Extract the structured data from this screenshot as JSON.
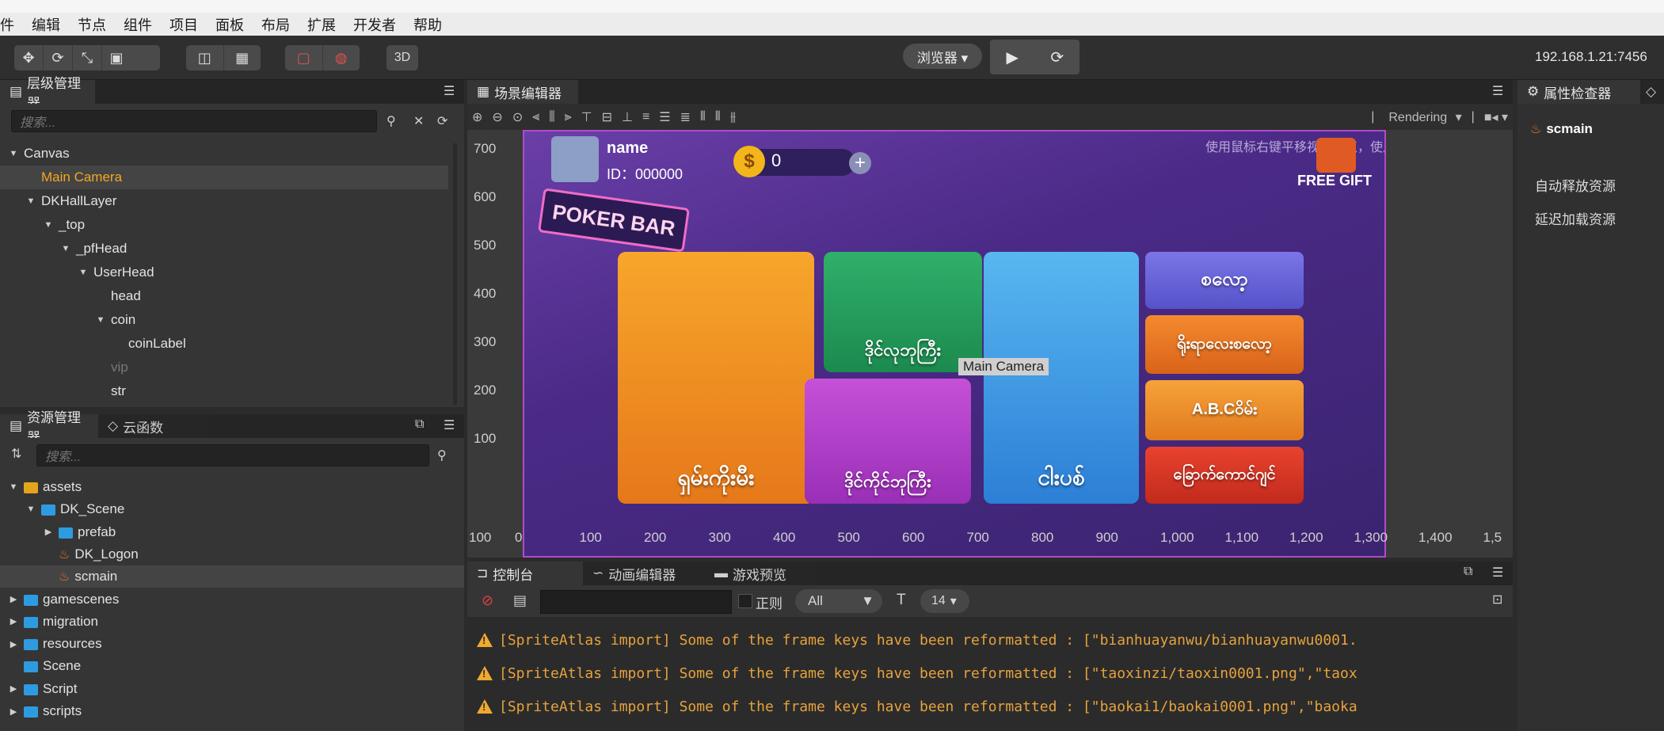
{
  "menubar": [
    "件",
    "编辑",
    "节点",
    "组件",
    "项目",
    "面板",
    "布局",
    "扩展",
    "开发者",
    "帮助"
  ],
  "toolbar": {
    "btn_3d": "3D",
    "browser_label": "浏览器 ▾",
    "ip": "192.168.1.21:7456"
  },
  "hierarchy": {
    "tab": "层级管理器",
    "search_placeholder": "搜索...",
    "nodes": [
      {
        "label": "Canvas",
        "depth": 0,
        "arrow": "▼"
      },
      {
        "label": "Main Camera",
        "depth": 1,
        "arrow": "",
        "selected": true
      },
      {
        "label": "DKHallLayer",
        "depth": 1,
        "arrow": "▼"
      },
      {
        "label": "_top",
        "depth": 2,
        "arrow": "▼"
      },
      {
        "label": "_pfHead",
        "depth": 3,
        "arrow": "▼"
      },
      {
        "label": "UserHead",
        "depth": 4,
        "arrow": "▼"
      },
      {
        "label": "head",
        "depth": 5,
        "arrow": ""
      },
      {
        "label": "coin",
        "depth": 5,
        "arrow": "▼"
      },
      {
        "label": "coinLabel",
        "depth": 6,
        "arrow": ""
      },
      {
        "label": "vip",
        "depth": 5,
        "arrow": "",
        "dim": true
      },
      {
        "label": "str",
        "depth": 5,
        "arrow": ""
      }
    ]
  },
  "assets": {
    "tab": "资源管理器",
    "tab2": "云函数",
    "search_placeholder": "搜索...",
    "items": [
      {
        "label": "assets",
        "depth": 0,
        "arrow": "▼",
        "kind": "db"
      },
      {
        "label": "DK_Scene",
        "depth": 1,
        "arrow": "▼",
        "kind": "folder"
      },
      {
        "label": "prefab",
        "depth": 2,
        "arrow": "▶",
        "kind": "folder"
      },
      {
        "label": "DK_Logon",
        "depth": 2,
        "arrow": "",
        "kind": "scene"
      },
      {
        "label": "scmain",
        "depth": 2,
        "arrow": "",
        "kind": "scene",
        "selected": true
      },
      {
        "label": "gamescenes",
        "depth": 0,
        "arrow": "▶",
        "kind": "folder"
      },
      {
        "label": "migration",
        "depth": 0,
        "arrow": "▶",
        "kind": "folder"
      },
      {
        "label": "resources",
        "depth": 0,
        "arrow": "▶",
        "kind": "folder"
      },
      {
        "label": "Scene",
        "depth": 0,
        "arrow": "",
        "kind": "folder"
      },
      {
        "label": "Script",
        "depth": 0,
        "arrow": "▶",
        "kind": "folder"
      },
      {
        "label": "scripts",
        "depth": 0,
        "arrow": "▶",
        "kind": "folder"
      }
    ]
  },
  "scene": {
    "tab": "场景编辑器",
    "rendering": "Rendering",
    "hint": "使用鼠标右键平移视图焦点，使用滚轮缩放视图",
    "camera_label": "Main Camera",
    "y_ticks": [
      "700",
      "600",
      "500",
      "400",
      "300",
      "200",
      "100"
    ],
    "x_ticks": [
      "100",
      "0",
      "100",
      "200",
      "300",
      "400",
      "500",
      "600",
      "700",
      "800",
      "900",
      "1,000",
      "1,100",
      "1,200",
      "1,300",
      "1,400",
      "1,5"
    ],
    "game": {
      "user_name": "name",
      "user_id": "ID：000000",
      "coin": "0",
      "free_gift": "FREE GIFT",
      "logo": "POKER BAR",
      "cards": [
        "ရှမ်းကိုးမီး",
        "ဒိုင်လုဘုကြီး",
        "ဒိုင်ကိုင်ဘုကြီး",
        "ငါးပစ်"
      ],
      "side_cards": [
        "စလော့",
        "ရိုးရာလေးစလော့",
        "A.B.Cဝိမ်း",
        "ခြောက်ကောင်ဂျင်"
      ]
    }
  },
  "console": {
    "tabs": [
      "控制台",
      "动画编辑器",
      "游戏预览"
    ],
    "regex_label": "正则",
    "filter": "All",
    "font_size": "14",
    "logs": [
      "[SpriteAtlas import] Some of the frame keys have been reformatted : [\"bianhuayanwu/bianhuayanwu0001.",
      "[SpriteAtlas import] Some of the frame keys have been reformatted : [\"taoxinzi/taoxin0001.png\",\"taox",
      "[SpriteAtlas import] Some of the frame keys have been reformatted : [\"baokai1/baokai0001.png\",\"baoka"
    ]
  },
  "inspector": {
    "tab": "属性检查器",
    "asset": "scmain",
    "options": [
      "自动释放资源",
      "延迟加载资源"
    ]
  }
}
